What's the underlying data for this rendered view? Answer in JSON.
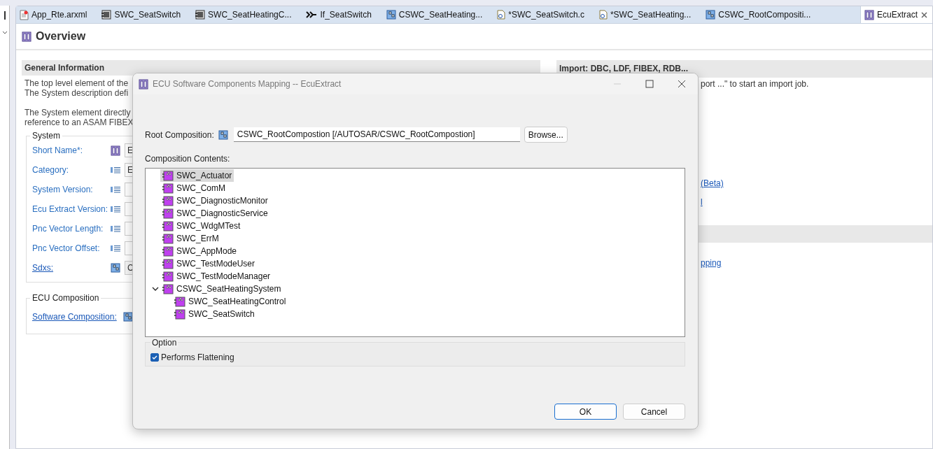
{
  "tabs": [
    {
      "label": "App_Rte.arxml",
      "kind": "arxml",
      "selected": false
    },
    {
      "label": "SWC_SeatSwitch",
      "kind": "component",
      "selected": false
    },
    {
      "label": "SWC_SeatHeatingC...",
      "kind": "component",
      "selected": false
    },
    {
      "label": "If_SeatSwitch",
      "kind": "interface",
      "selected": false
    },
    {
      "label": "CSWC_SeatHeating...",
      "kind": "composition",
      "selected": false
    },
    {
      "label": "*SWC_SeatSwitch.c",
      "kind": "source",
      "selected": false
    },
    {
      "label": "*SWC_SeatHeating...",
      "kind": "source",
      "selected": false
    },
    {
      "label": "CSWC_RootCompositi...",
      "kind": "composition",
      "selected": false
    },
    {
      "label": "EcuExtract",
      "kind": "ecu",
      "selected": true
    }
  ],
  "editor": {
    "title": "Overview",
    "general_information": {
      "heading": "General Information",
      "paragraphs": [
        "The top level element of the\nThe System description defi",
        "The System element directly\nreference to an ASAM FIBEX"
      ]
    },
    "system_group": {
      "legend": "System",
      "fields": [
        {
          "label": "Short Name*:",
          "kind": "name",
          "link": false,
          "value": "E"
        },
        {
          "label": "Category:",
          "kind": "text",
          "link": false,
          "value": "E"
        },
        {
          "label": "System Version:",
          "kind": "text",
          "link": false
        },
        {
          "label": "Ecu Extract Version:",
          "kind": "text",
          "link": false
        },
        {
          "label": "Pnc Vector Length:",
          "kind": "text",
          "link": false
        },
        {
          "label": "Pnc Vector Offset:",
          "kind": "text",
          "link": false
        },
        {
          "label": "Sdxs:",
          "kind": "reference",
          "link": true,
          "value": "C"
        }
      ]
    },
    "ecu_composition_group": {
      "legend": "ECU Composition",
      "fields": [
        {
          "label": "Software Composition:",
          "kind": "reference",
          "link": true
        }
      ]
    },
    "import_section": {
      "heading": "Import: DBC, LDF, FIBEX, RDB...",
      "text": "port ...\" to start an import job.",
      "links": [
        "(Beta)",
        "l"
      ]
    },
    "second_section": {
      "links": [
        "pping"
      ]
    }
  },
  "dialog": {
    "title": "ECU Software Components Mapping -- EcuExtract",
    "root_composition": {
      "label": "Root Composition:",
      "value": "CSWC_RootCompostion [/AUTOSAR/CSWC_RootCompostion]",
      "button": "Browse..."
    },
    "contents_label": "Composition Contents:",
    "tree": [
      {
        "label": "SWC_Actuator",
        "selected": true
      },
      {
        "label": "SWC_ComM",
        "selected": false
      },
      {
        "label": "SWC_DiagnosticMonitor",
        "selected": false
      },
      {
        "label": "SWC_DiagnosticService",
        "selected": false
      },
      {
        "label": "SWC_WdgMTest",
        "selected": false
      },
      {
        "label": "SWC_ErrM",
        "selected": false
      },
      {
        "label": "SWC_AppMode",
        "selected": false
      },
      {
        "label": "SWC_TestModeUser",
        "selected": false
      },
      {
        "label": "SWC_TestModeManager",
        "selected": false
      },
      {
        "label": "CSWC_SeatHeatingSystem",
        "selected": false,
        "expanded": true,
        "children": [
          {
            "label": "SWC_SeatHeatingControl",
            "selected": false
          },
          {
            "label": "SWC_SeatSwitch",
            "selected": false
          }
        ]
      }
    ],
    "option": {
      "legend": "Option",
      "checkbox": {
        "label": "Performs Flattening",
        "checked": true
      }
    },
    "buttons": [
      {
        "label": "OK",
        "default": true
      },
      {
        "label": "Cancel",
        "default": false
      }
    ]
  }
}
